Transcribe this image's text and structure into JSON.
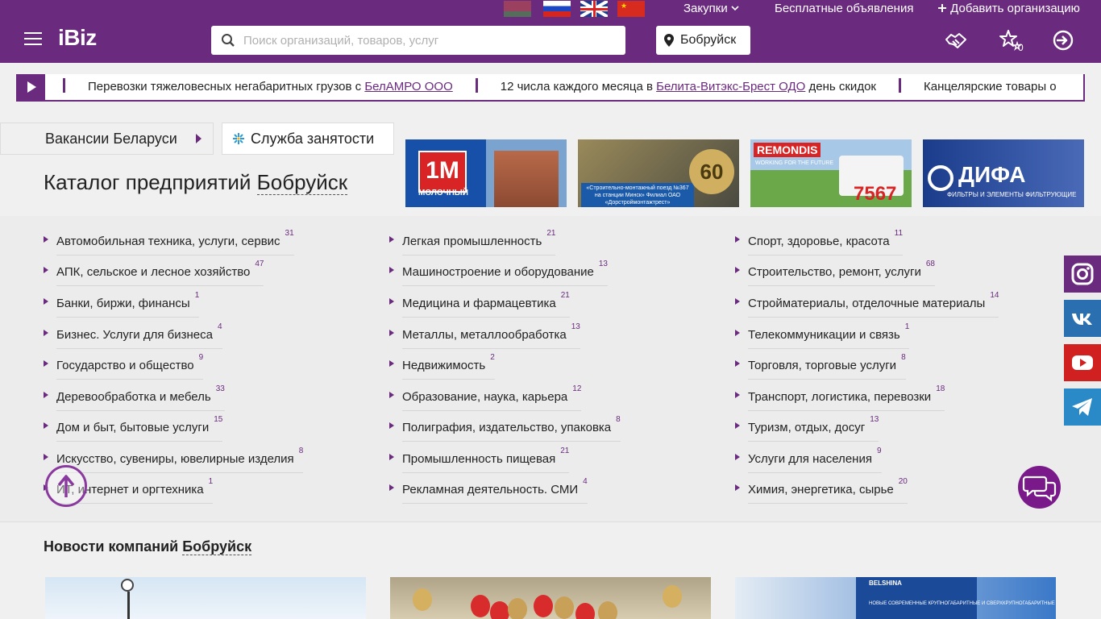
{
  "topbar": {
    "flags": [
      "by",
      "ru",
      "en",
      "cn"
    ],
    "purchases": "Закупки",
    "free_ads": "Бесплатные объявления",
    "add_org": "Добавить организацию"
  },
  "header": {
    "logo": "iBiz",
    "search_placeholder": "Поиск организаций, товаров, услуг",
    "city": "Бобруйск",
    "favorites_count": "0",
    "icons": [
      "handshake-icon",
      "stars-icon",
      "login-icon"
    ]
  },
  "ticker": {
    "items": [
      {
        "pre": "Перевозки тяжеловесных негабаритных грузов с ",
        "link": "БелАМРО ООО",
        "post": ""
      },
      {
        "pre": "12 числа каждого месяца в ",
        "link": "Белита-Витэкс-Брест ОДО",
        "post": " день скидок"
      },
      {
        "pre": "Канцелярские товары о",
        "link": "",
        "post": ""
      }
    ]
  },
  "buttons": {
    "vacancies": "Вакансии Беларуси",
    "employment": "Служба занятости"
  },
  "catalog": {
    "title_prefix": "Каталог предприятий ",
    "title_city": "Бобруйск",
    "columns": [
      [
        {
          "label": "Автомобильная техника, услуги, сервис",
          "count": "31"
        },
        {
          "label": "АПК, сельское и лесное хозяйство",
          "count": "47"
        },
        {
          "label": "Банки, биржи, финансы",
          "count": "1"
        },
        {
          "label": "Бизнес. Услуги для бизнеса",
          "count": "4"
        },
        {
          "label": "Государство и общество",
          "count": "9"
        },
        {
          "label": "Деревообработка и мебель",
          "count": "33"
        },
        {
          "label": "Дом и быт, бытовые услуги",
          "count": "15"
        },
        {
          "label": "Искусство, сувениры, ювелирные изделия",
          "count": "8"
        },
        {
          "label": "ИТ, интернет и оргтехника",
          "count": "1"
        }
      ],
      [
        {
          "label": "Легкая промышленность",
          "count": "21"
        },
        {
          "label": "Машиностроение и оборудование",
          "count": "13"
        },
        {
          "label": "Медицина и фармацевтика",
          "count": "21"
        },
        {
          "label": "Металлы, металлообработка",
          "count": "13"
        },
        {
          "label": "Недвижимость",
          "count": "2"
        },
        {
          "label": "Образование, наука, карьера",
          "count": "12"
        },
        {
          "label": "Полиграфия, издательство, упаковка",
          "count": "8"
        },
        {
          "label": "Промышленность пищевая",
          "count": "21"
        },
        {
          "label": "Рекламная деятельность. СМИ",
          "count": "4"
        }
      ],
      [
        {
          "label": "Спорт, здоровье, красота",
          "count": "11"
        },
        {
          "label": "Строительство, ремонт, услуги",
          "count": "68"
        },
        {
          "label": "Стройматериалы, отделочные материалы",
          "count": "14"
        },
        {
          "label": "Телекоммуникации и связь",
          "count": "1"
        },
        {
          "label": "Торговля, торговые услуги",
          "count": "8"
        },
        {
          "label": "Транспорт, логистика, перевозки",
          "count": "18"
        },
        {
          "label": "Туризм, отдых, досуг",
          "count": "13"
        },
        {
          "label": "Услуги для населения",
          "count": "9"
        },
        {
          "label": "Химия, энергетика, сырье",
          "count": "20"
        }
      ]
    ]
  },
  "banners": [
    {
      "title": "1М",
      "subtitle": "МОЛОЧНЫЙ"
    },
    {
      "title": "60",
      "subtitle": "«Строительно-монтажный поезд №367 на станции Минск» Филиал ОАО «Дорстроймонтажтрест»"
    },
    {
      "title": "REMONDIS",
      "subtitle": "WORKING FOR THE FUTURE",
      "number": "7567"
    },
    {
      "title": "ДИФА",
      "subtitle": "ФИЛЬТРЫ И ЭЛЕМЕНТЫ ФИЛЬТРУЮЩИЕ"
    }
  ],
  "news": {
    "title_prefix": "Новости компаний ",
    "title_city": "Бобруйск",
    "card3_title": "BELSHINA",
    "card3_text": "НОВЫЕ СОВРЕМЕННЫЕ КРУПНОГАБАРИТНЫЕ И СВЕРХКРУПНОГАБАРИТНЫЕ"
  },
  "social": [
    "instagram-icon",
    "vk-icon",
    "youtube-icon",
    "telegram-icon"
  ],
  "colors": {
    "brand": "#6a2a7e",
    "chat": "#7a1a8a"
  }
}
